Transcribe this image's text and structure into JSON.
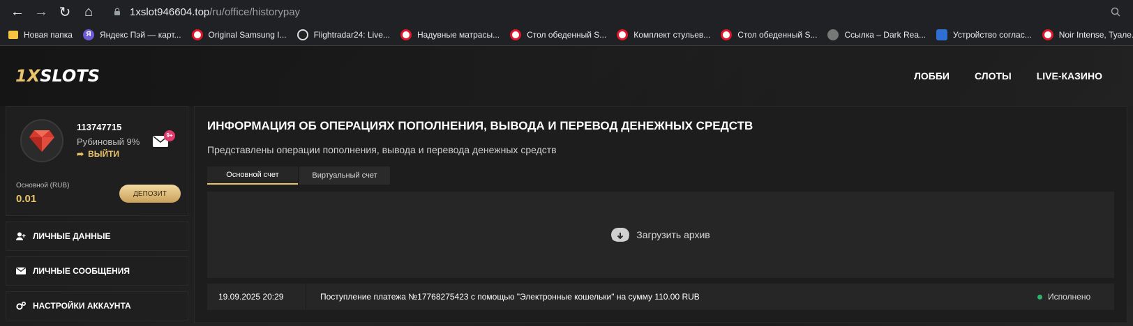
{
  "browser": {
    "url_host": "1xslot946604.top",
    "url_path": "/ru/office/historypay",
    "bookmarks": [
      {
        "label": "Новая папка",
        "icon": "folder-icon"
      },
      {
        "label": "Яндекс Пэй — карт...",
        "icon": "yandex-icon"
      },
      {
        "label": "Original Samsung I...",
        "icon": "ozon-icon"
      },
      {
        "label": "Flightradar24: Live...",
        "icon": "flightradar-icon"
      },
      {
        "label": "Надувные матрасы...",
        "icon": "ozon-icon"
      },
      {
        "label": "Стол обеденный S...",
        "icon": "ozon-icon"
      },
      {
        "label": "Комплект стульев...",
        "icon": "ozon-icon"
      },
      {
        "label": "Стол обеденный S...",
        "icon": "ozon-icon"
      },
      {
        "label": "Ссылка – Dark Rea...",
        "icon": "dark-reader-icon"
      },
      {
        "label": "Устройство соглас...",
        "icon": "gosuslugi-icon"
      },
      {
        "label": "Noir Intense, Туале...",
        "icon": "ozon-icon"
      }
    ]
  },
  "site": {
    "logo_prefix": "1X",
    "logo_suffix": "SLOTS",
    "nav": [
      "ЛОББИ",
      "СЛОТЫ",
      "LIVE-КАЗИНО"
    ]
  },
  "profile": {
    "user_id": "113747715",
    "level": "Рубиновый 9%",
    "logout": "ВЫЙТИ",
    "mail_badge": "9+",
    "balance_label": "Основной (RUB)",
    "balance_value": "0.01",
    "deposit": "ДЕПОЗИТ"
  },
  "menu": [
    {
      "label": "ЛИЧНЫЕ ДАННЫЕ",
      "icon": "add-user-icon"
    },
    {
      "label": "ЛИЧНЫЕ СООБЩЕНИЯ",
      "icon": "envelope-icon"
    },
    {
      "label": "НАСТРОЙКИ АККАУНТА",
      "icon": "gears-icon"
    }
  ],
  "main": {
    "title": "ИНФОРМАЦИЯ ОБ ОПЕРАЦИЯХ ПОПОЛНЕНИЯ, ВЫВОДА И ПЕРЕВОД ДЕНЕЖНЫХ СРЕДСТВ",
    "subtitle": "Представлены операции пополнения, вывода и перевода денежных средств",
    "tabs": [
      "Основной счет",
      "Виртуальный счет"
    ],
    "archive": "Загрузить архив",
    "rows": [
      {
        "date": "19.09.2025 20:29",
        "description": "Поступление платежа №17768275423 с помощью \"Электронные кошельки\" на сумму 110.00 RUB",
        "status": "Исполнено"
      }
    ]
  },
  "colors": {
    "accent": "#e9c46a",
    "status_ok": "#2fb36a",
    "badge": "#e33b6e"
  }
}
